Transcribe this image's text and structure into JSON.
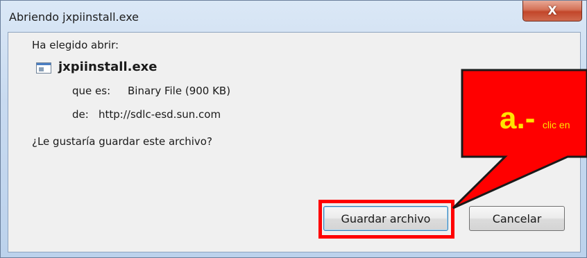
{
  "window": {
    "title": "Abriendo jxpiinstall.exe",
    "close_label": "X"
  },
  "dialog": {
    "intro": "Ha elegido abrir:",
    "file_name": "jxpiinstall.exe",
    "type_label": "que es:",
    "type_value": "Binary File (900 KB)",
    "from_label": "de:",
    "from_value": "http://sdlc-esd.sun.com",
    "question": "¿Le gustaría guardar este archivo?"
  },
  "buttons": {
    "save": "Guardar archivo",
    "cancel": "Cancelar"
  },
  "annotation": {
    "step": "a.-",
    "text": "clic en"
  },
  "colors": {
    "callout_fill": "#ff0000",
    "callout_text": "#ffe400",
    "highlight_outline": "#ff0000"
  }
}
